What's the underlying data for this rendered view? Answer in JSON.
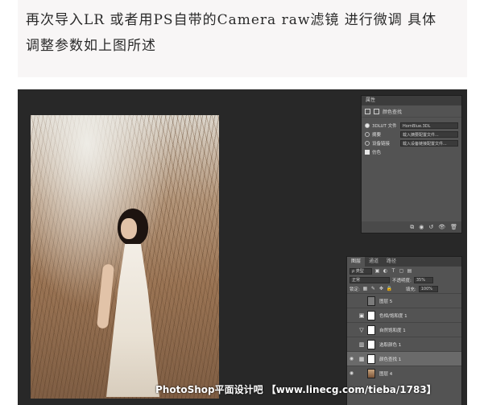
{
  "caption": {
    "line1": "再次导入LR 或者用PS自带的Camera raw滤镜 进行微调 具体",
    "line2": "调整参数如上图所述"
  },
  "properties": {
    "header": "属性",
    "subtitle": "颜色查找",
    "rows": [
      {
        "label": "3DLUT 文件",
        "value": "HornBlue.3DL",
        "selected": true
      },
      {
        "label": "摘要",
        "value": "载入摘要配置文件...",
        "selected": false
      },
      {
        "label": "设备链接",
        "value": "载入设备链接配置文件...",
        "selected": false
      }
    ],
    "dither_label": "仿色",
    "dither_checked": true
  },
  "layers": {
    "tabs": [
      "图层",
      "通道",
      "路径"
    ],
    "active_tab": "图层",
    "filter_label": "ρ 类型",
    "blend_mode": "正常",
    "opacity_label": "不透明度:",
    "opacity_value": "35%",
    "lock_label": "锁定:",
    "fill_label": "填充:",
    "fill_value": "100%",
    "items": [
      {
        "name": "图层 5",
        "type": "pixel",
        "visible": false,
        "selected": false
      },
      {
        "name": "色相/饱和度 1",
        "type": "adjust",
        "icon": "▣",
        "visible": false,
        "selected": false
      },
      {
        "name": "自然饱和度 1",
        "type": "adjust",
        "icon": "▽",
        "visible": false,
        "selected": false
      },
      {
        "name": "选取颜色 1",
        "type": "adjust",
        "icon": "▥",
        "visible": false,
        "selected": false
      },
      {
        "name": "颜色查找 1",
        "type": "adjust",
        "icon": "▦",
        "visible": true,
        "selected": true
      },
      {
        "name": "图层 4",
        "type": "photo",
        "visible": true,
        "selected": false
      }
    ]
  },
  "watermark": "PhotoShop平面设计吧 【www.linecg.com/tieba/1783】"
}
